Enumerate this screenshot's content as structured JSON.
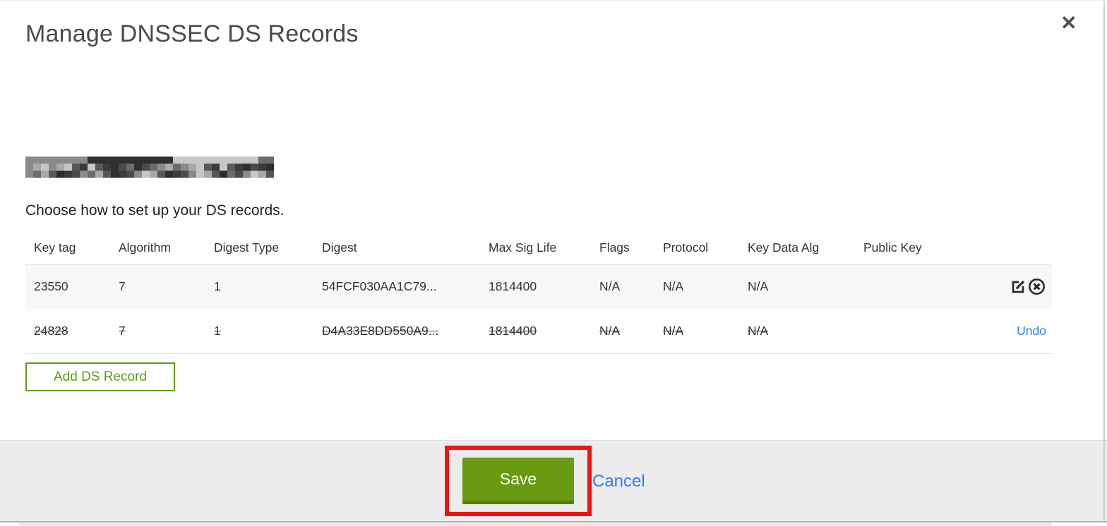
{
  "dialog": {
    "title": "Manage DNSSEC DS Records",
    "subtitle": "Choose how to set up your DS records."
  },
  "icons": {
    "close-icon": "✕",
    "edit-icon": "pencil-in-square",
    "delete-icon": "x-in-circle"
  },
  "table": {
    "headers": [
      "Key tag",
      "Algorithm",
      "Digest Type",
      "Digest",
      "Max Sig Life",
      "Flags",
      "Protocol",
      "Key Data Alg",
      "Public Key"
    ],
    "rows": [
      {
        "cells": [
          "23550",
          "7",
          "1",
          "54FCF030AA1C79...",
          "1814400",
          "N/A",
          "N/A",
          "N/A",
          ""
        ],
        "deleted": false
      },
      {
        "cells": [
          "24828",
          "7",
          "1",
          "D4A33E8DD550A9...",
          "1814400",
          "N/A",
          "N/A",
          "N/A",
          ""
        ],
        "deleted": true
      }
    ],
    "undo_label": "Undo"
  },
  "buttons": {
    "add_record": "Add DS Record",
    "save": "Save",
    "cancel": "Cancel"
  },
  "colors": {
    "accent_green": "#689b12",
    "green_border": "#5f9c1b",
    "link_blue": "#2d7ef7",
    "annotation_red": "#ee1511"
  }
}
